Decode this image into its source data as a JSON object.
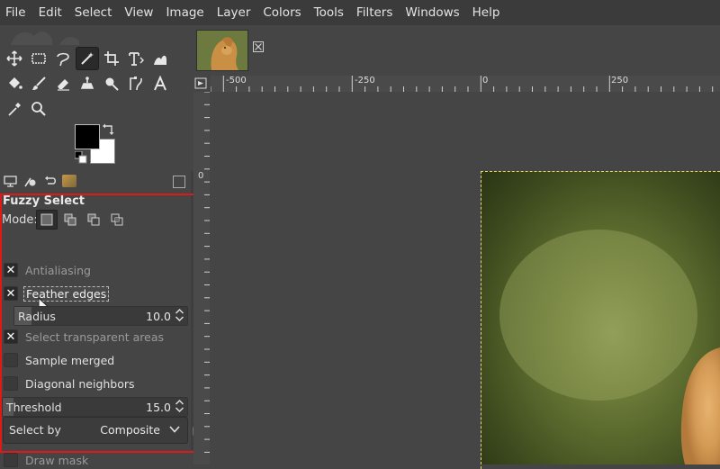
{
  "menubar": {
    "items": [
      "File",
      "Edit",
      "Select",
      "View",
      "Image",
      "Layer",
      "Colors",
      "Tools",
      "Filters",
      "Windows",
      "Help"
    ]
  },
  "toolbox": {
    "tools_row1": [
      "move-tool-icon",
      "rect-select-tool-icon",
      "free-select-tool-icon",
      "fuzzy-select-tool-icon",
      "crop-tool-icon",
      "transform-tool-icon",
      "warp-tool-icon"
    ],
    "tools_row2": [
      "bucket-fill-tool-icon",
      "paintbrush-tool-icon",
      "eraser-tool-icon",
      "clone-tool-icon",
      "smudge-tool-icon",
      "paths-tool-icon",
      "text-tool-icon"
    ],
    "tools_row3": [
      "color-picker-tool-icon",
      "zoom-tool-icon"
    ],
    "active_tool": "fuzzy-select-tool-icon",
    "foreground_color": "#000000",
    "background_color": "#ffffff"
  },
  "tool_options": {
    "title": "Fuzzy Select",
    "mode_label": "Mode:",
    "antialiasing": {
      "label": "Antialiasing",
      "checked": true
    },
    "feather_edges": {
      "label": "Feather edges",
      "checked": true
    },
    "radius": {
      "label": "Radius",
      "value": "10.0",
      "fill_fraction": 0.1
    },
    "select_transparent": {
      "label": "Select transparent areas",
      "checked": true
    },
    "sample_merged": {
      "label": "Sample merged",
      "checked": false
    },
    "diagonal_neighbors": {
      "label": "Diagonal neighbors",
      "checked": false
    },
    "threshold": {
      "label": "Threshold",
      "value": "15.0",
      "fill_fraction": 0.06
    },
    "select_by": {
      "label": "Select by",
      "value": "Composite"
    },
    "draw_mask": {
      "label": "Draw mask",
      "checked": false
    }
  },
  "ruler": {
    "h_labels": [
      "-500",
      "-250",
      "0",
      "250"
    ],
    "v_labels": [
      "0"
    ]
  },
  "colors": {
    "highlight": "#e01818",
    "selection": "#e8d86a"
  }
}
